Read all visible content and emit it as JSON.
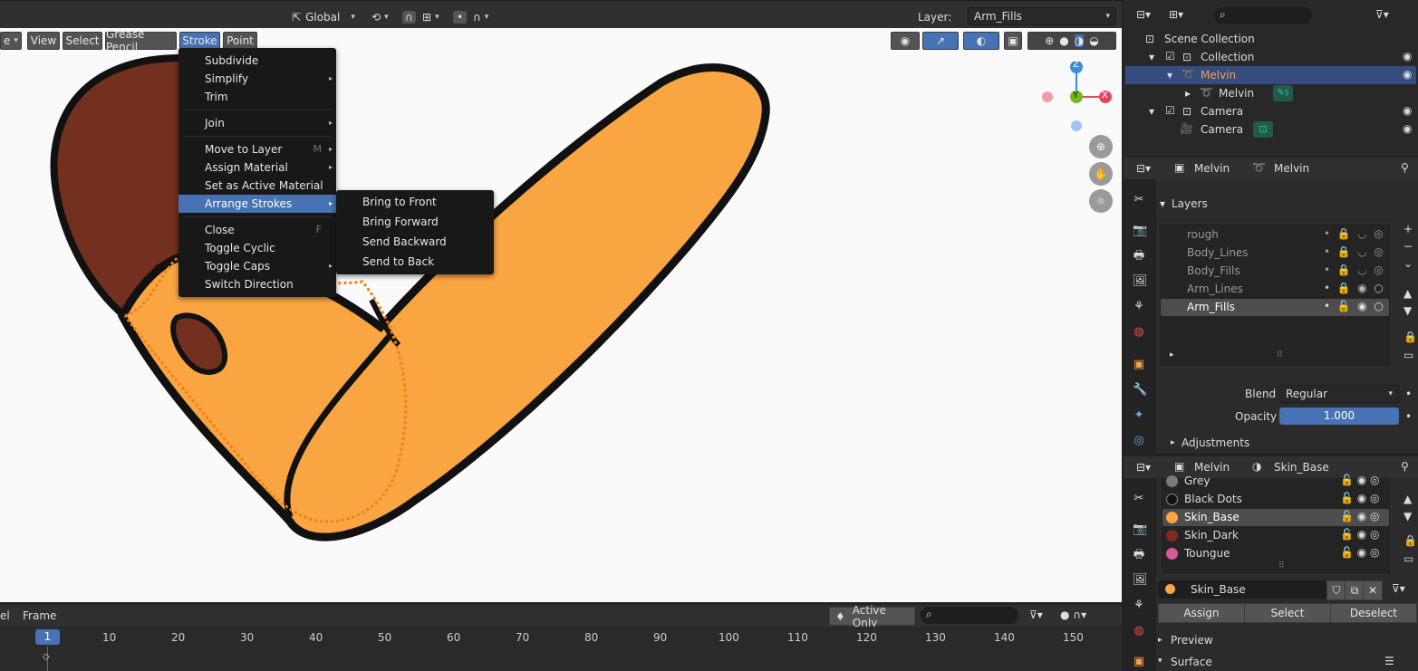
{
  "header": {
    "transform_orientation": "Global",
    "layer_label": "Layer:",
    "layer_value": "Arm_Fills"
  },
  "viewport_menu": {
    "mode_suffix": "e",
    "items": [
      "View",
      "Select",
      "Grease Pencil",
      "Stroke",
      "Point"
    ]
  },
  "stroke_menu": {
    "items": [
      {
        "label": "Subdivide"
      },
      {
        "label": "Simplify"
      },
      {
        "label": "Trim"
      },
      {
        "label": "Join"
      },
      {
        "label": "Move to Layer",
        "shortcut": "M"
      },
      {
        "label": "Assign Material"
      },
      {
        "label": "Set as Active Material"
      },
      {
        "label": "Arrange Strokes"
      },
      {
        "label": "Close",
        "shortcut": "F"
      },
      {
        "label": "Toggle Cyclic"
      },
      {
        "label": "Toggle Caps"
      },
      {
        "label": "Switch Direction"
      }
    ]
  },
  "arrange_submenu": {
    "items": [
      "Bring to Front",
      "Bring Forward",
      "Send Backward",
      "Send to Back"
    ]
  },
  "gizmo": {
    "z": "Z",
    "y": "Y",
    "x": "X"
  },
  "timeline": {
    "left_labels": [
      "el",
      "Frame"
    ],
    "active_only": "Active Only",
    "current_frame": "1",
    "ticks": [
      "10",
      "20",
      "30",
      "40",
      "50",
      "60",
      "70",
      "80",
      "90",
      "100",
      "110",
      "120",
      "130",
      "140",
      "150"
    ]
  },
  "outliner": {
    "rows": [
      "Scene Collection",
      "Collection",
      "Melvin",
      "Melvin",
      "Camera",
      "Camera"
    ],
    "badge": "5"
  },
  "props1": {
    "object_name": "Melvin",
    "data_name": "Melvin",
    "section": "Layers",
    "layers": [
      "rough",
      "Body_Lines",
      "Body_Fills",
      "Arm_Lines",
      "Arm_Fills"
    ],
    "blend_label": "Blend",
    "blend_value": "Regular",
    "opacity_label": "Opacity",
    "opacity_value": "1.000",
    "opacity_fraction": 1.0,
    "adjustments": "Adjustments"
  },
  "props2": {
    "object_name": "Melvin",
    "material_name": "Skin_Base",
    "materials": [
      {
        "name": "Grey",
        "color": "#7a7a7a"
      },
      {
        "name": "Black Dots",
        "color": "#111111"
      },
      {
        "name": "Skin_Base",
        "color": "#f8a542"
      },
      {
        "name": "Skin_Dark",
        "color": "#7b2e1d"
      },
      {
        "name": "Toungue",
        "color": "#d35c97"
      }
    ],
    "slot_name": "Skin_Base",
    "buttons": [
      "Assign",
      "Select",
      "Deselect"
    ],
    "sections": [
      "Preview",
      "Surface"
    ]
  },
  "colors": {
    "accent": "#4772b3",
    "skin_base": "#f8a542",
    "skin_dark": "#73301f",
    "outline": "#111111",
    "selected_stroke": "#f57f12"
  }
}
